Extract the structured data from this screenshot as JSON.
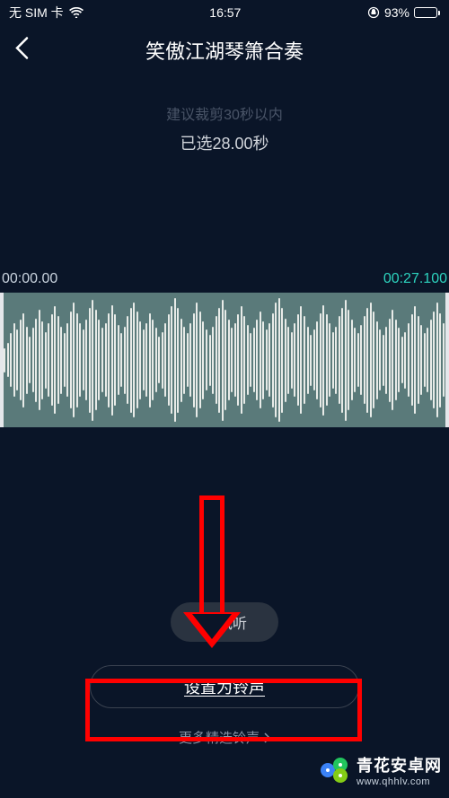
{
  "status": {
    "carrier": "无 SIM 卡",
    "time": "16:57",
    "battery_pct": "93%"
  },
  "header": {
    "title": "笑傲江湖琴箫合奏"
  },
  "editor": {
    "hint": "建议裁剪30秒以内",
    "selected_label": "已选28.00秒",
    "start_time": "00:00.00",
    "end_time": "00:27.100"
  },
  "buttons": {
    "preview": "试听",
    "set_ringtone": "设置为铃声",
    "more_ringtones": "更多精选铃声"
  },
  "watermark": {
    "brand": "青花安卓网",
    "url": "www.qhhlv.com"
  },
  "colors": {
    "bg": "#0a1528",
    "accent": "#2dd4bf",
    "annotation": "#ff0000"
  }
}
